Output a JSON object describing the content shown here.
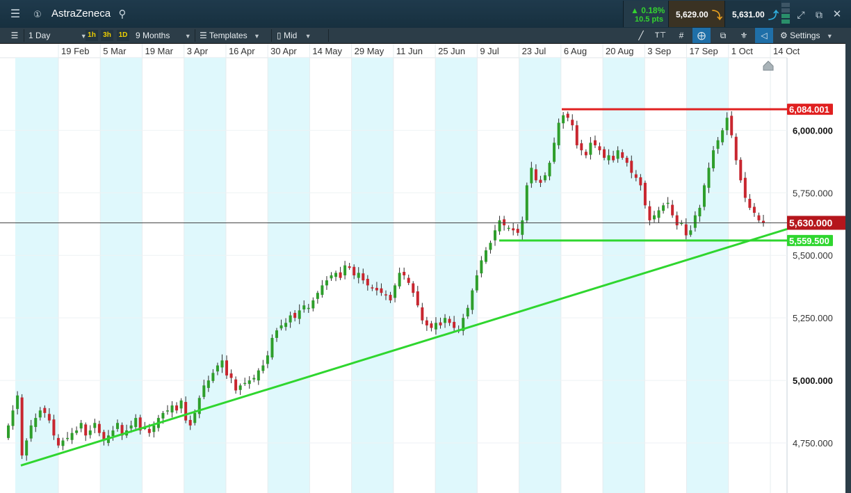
{
  "window": {
    "title": "AstraZeneca",
    "change_pct": "0.18%",
    "change_pts": "10.5 pts",
    "sell_price": "5,629.00",
    "buy_price": "5,631.00",
    "colors": {
      "titlebar": "#1b3444",
      "up": "#34d32f",
      "sell_arrow": "#e8a020",
      "buy_arrow": "#2fb0e0"
    }
  },
  "toolbar": {
    "interval": "1 Day",
    "timeframes": [
      "1h",
      "3h",
      "1D"
    ],
    "range": "9 Months",
    "templates": "Templates",
    "price_type": "Mid",
    "settings": "Settings"
  },
  "chart_data": {
    "type": "candlestick",
    "x_ticks": [
      "19 Feb",
      "5 Mar",
      "19 Mar",
      "3 Apr",
      "16 Apr",
      "30 Apr",
      "14 May",
      "29 May",
      "11 Jun",
      "25 Jun",
      "9 Jul",
      "23 Jul",
      "6 Aug",
      "20 Aug",
      "3 Sep",
      "17 Sep",
      "1 Oct",
      "14 Oct"
    ],
    "y_ticks": [
      "6,000.000",
      "5,750.000",
      "5,500.000",
      "5,250.000",
      "5,000.000",
      "4,750.000"
    ],
    "ylim": [
      4500,
      6240
    ],
    "price_labels": {
      "resistance": "6,084.001",
      "current": "5,630.000",
      "support": "5,559.500"
    },
    "closes": [
      4820,
      4880,
      4940,
      4700,
      4760,
      4820,
      4850,
      4880,
      4870,
      4840,
      4780,
      4740,
      4760,
      4770,
      4790,
      4800,
      4830,
      4780,
      4800,
      4830,
      4790,
      4760,
      4780,
      4800,
      4830,
      4780,
      4800,
      4820,
      4850,
      4800,
      4810,
      4790,
      4820,
      4850,
      4870,
      4880,
      4900,
      4880,
      4920,
      4840,
      4820,
      4870,
      4930,
      4980,
      5000,
      5030,
      5060,
      5080,
      5020,
      5010,
      4960,
      4980,
      4990,
      5000,
      5010,
      5040,
      5060,
      5100,
      5170,
      5200,
      5220,
      5230,
      5260,
      5250,
      5280,
      5300,
      5290,
      5320,
      5350,
      5380,
      5400,
      5420,
      5430,
      5410,
      5460,
      5450,
      5420,
      5430,
      5400,
      5380,
      5370,
      5360,
      5350,
      5340,
      5320,
      5380,
      5430,
      5420,
      5390,
      5350,
      5300,
      5240,
      5220,
      5210,
      5230,
      5220,
      5250,
      5230,
      5210,
      5200,
      5250,
      5290,
      5360,
      5420,
      5480,
      5520,
      5550,
      5600,
      5640,
      5620,
      5610,
      5600,
      5590,
      5640,
      5780,
      5850,
      5800,
      5790,
      5820,
      5870,
      5950,
      6030,
      6060,
      6050,
      6020,
      5940,
      5920,
      5900,
      5950,
      5940,
      5920,
      5890,
      5900,
      5880,
      5920,
      5890,
      5870,
      5830,
      5810,
      5780,
      5700,
      5640,
      5660,
      5680,
      5700,
      5710,
      5660,
      5620,
      5630,
      5580,
      5600,
      5660,
      5690,
      5780,
      5850,
      5920,
      5960,
      6000,
      6050,
      5980,
      5880,
      5800,
      5730,
      5690,
      5670,
      5640,
      5630
    ],
    "support_level": 5559.5,
    "resistance_level": 6084.001,
    "current_level": 5630,
    "trendline": {
      "start": 4660,
      "end": 5605
    }
  }
}
